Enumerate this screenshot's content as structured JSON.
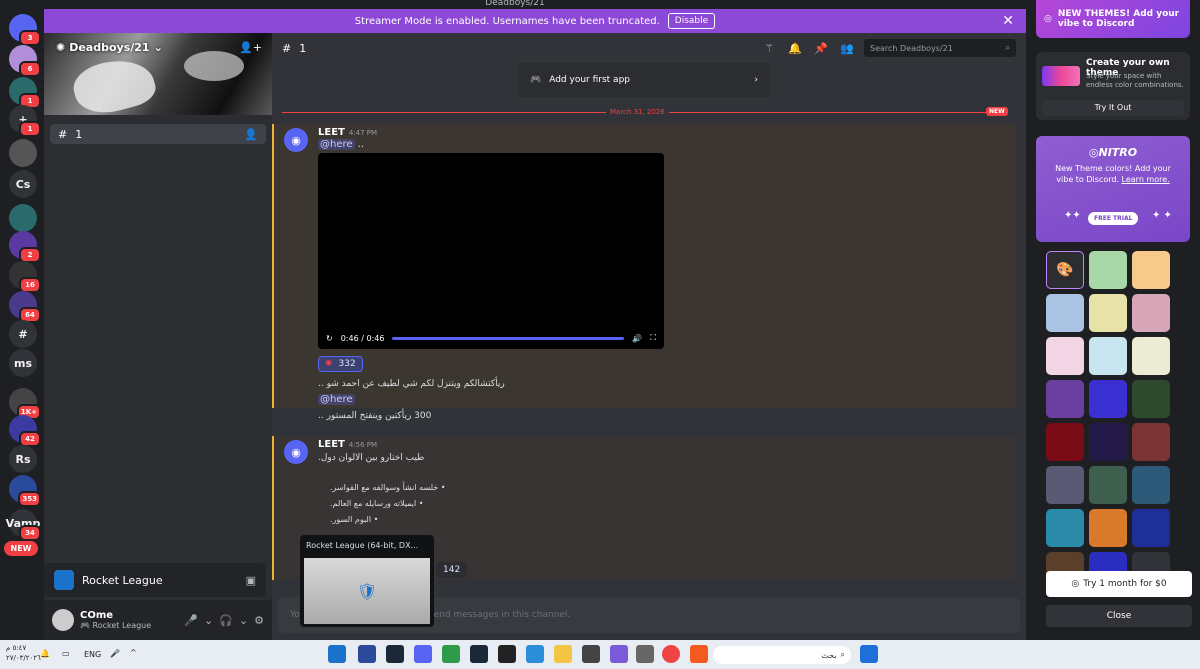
{
  "window_title": "Deadboys/21",
  "banner": {
    "text": "Streamer Mode is enabled. Usernames have been truncated.",
    "button": "Disable",
    "close": "✕"
  },
  "rail": [
    {
      "label": "",
      "icon": "discord-icon",
      "badge": "3"
    },
    {
      "label": "",
      "icon": "avatar",
      "badge": "6"
    },
    {
      "label": "",
      "icon": "server-logo",
      "badge": "1"
    },
    {
      "label": "+",
      "icon": "add-server-icon",
      "badge": "1"
    },
    {
      "label": "",
      "icon": "server-image",
      "badge": ""
    },
    {
      "label": "Cs",
      "icon": "",
      "badge": ""
    },
    {
      "label": "",
      "icon": "server-logo",
      "badge": ""
    },
    {
      "label": "",
      "icon": "server-image",
      "badge": "2"
    },
    {
      "label": "",
      "icon": "server-image",
      "badge": "16"
    },
    {
      "label": "",
      "icon": "server-image",
      "badge": "64"
    },
    {
      "label": "#",
      "icon": "server-image",
      "badge": ""
    },
    {
      "label": "ms",
      "icon": "",
      "badge": ""
    },
    {
      "label": "",
      "icon": "server-image",
      "badge": "1K+"
    },
    {
      "label": "",
      "icon": "server-image",
      "badge": "42"
    },
    {
      "label": "Rs",
      "icon": "",
      "badge": ""
    },
    {
      "label": "",
      "icon": "server-image",
      "badge": "353"
    },
    {
      "label": "Vamp",
      "icon": "server-image",
      "badge": "34"
    }
  ],
  "rail_new": "NEW",
  "sidebar": {
    "server_name": "Deadboys/21",
    "channel": "1",
    "activity_game": "Rocket League",
    "user": {
      "name": "COme",
      "status": "Rocket League"
    }
  },
  "header": {
    "channel": "1",
    "search_placeholder": "Search Deadboys/21"
  },
  "app_card": "Add your first app",
  "divider": {
    "date": "March 31, 2026",
    "new": "NEW"
  },
  "messages": [
    {
      "author": "LEET",
      "time": "4:47 PM",
      "line1_mention": "@here",
      "line1_rest": " ..",
      "video_time": "0:46 / 0:46",
      "reaction_count": "332",
      "arabic1": "ريأكتشالكم ويتنزل لكم شي لطيف عن احمد شو ..",
      "mention2": "@here",
      "arabic2": "300 ريأكتين وينفتح المستور .."
    },
    {
      "author": "LEET",
      "time": "4:56 PM",
      "intro": "طيب اختارو بين الالوان دول.",
      "bullets": [
        "خلسه انشأ وسوالفه مع القواسر.",
        "ايميلاته ورسايله مع العالم.",
        "البوم السور."
      ],
      "reaction_count": "142"
    }
  ],
  "input_placeholder": "You do not have permission to send messages in this channel.",
  "popup_title": "Rocket League (64-bit, DX...",
  "right_panel": {
    "promo_top": "NEW THEMES! Add your vibe to Discord",
    "create_title": "Create your own theme",
    "create_desc": "Style your space with endless color combinations.",
    "try_it": "Try It Out",
    "nitro_logo": "NITRO",
    "nitro_text": "New Theme colors! Add your vibe to Discord. ",
    "nitro_link": "Learn more.",
    "free_trial": "FREE TRIAL",
    "try_month": "Try 1 month for $0",
    "close": "Close"
  },
  "swatches": [
    "#2b2d31",
    "#a8d8a8",
    "#f7c98b",
    "#a9c3e3",
    "#e7e2a8",
    "#d7a7b7",
    "#f2d5e4",
    "#c7e6f0",
    "#ecebd4",
    "#6b3fa0",
    "#3a2fd0",
    "#2e4a2e",
    "#7a0c18",
    "#241a4a",
    "#7a3434",
    "#5a5a75",
    "#3e5f4e",
    "#2e5a7a",
    "#2a8aa8",
    "#d9792a",
    "#1f2f9a",
    "#5a3f2a",
    "#2b2dc0",
    "#313338"
  ],
  "taskbar": {
    "time": "٥:٤٧ م",
    "date": "٢٧/٠٣/٢٠٢٦",
    "lang": "ENG",
    "search": "بحث"
  }
}
